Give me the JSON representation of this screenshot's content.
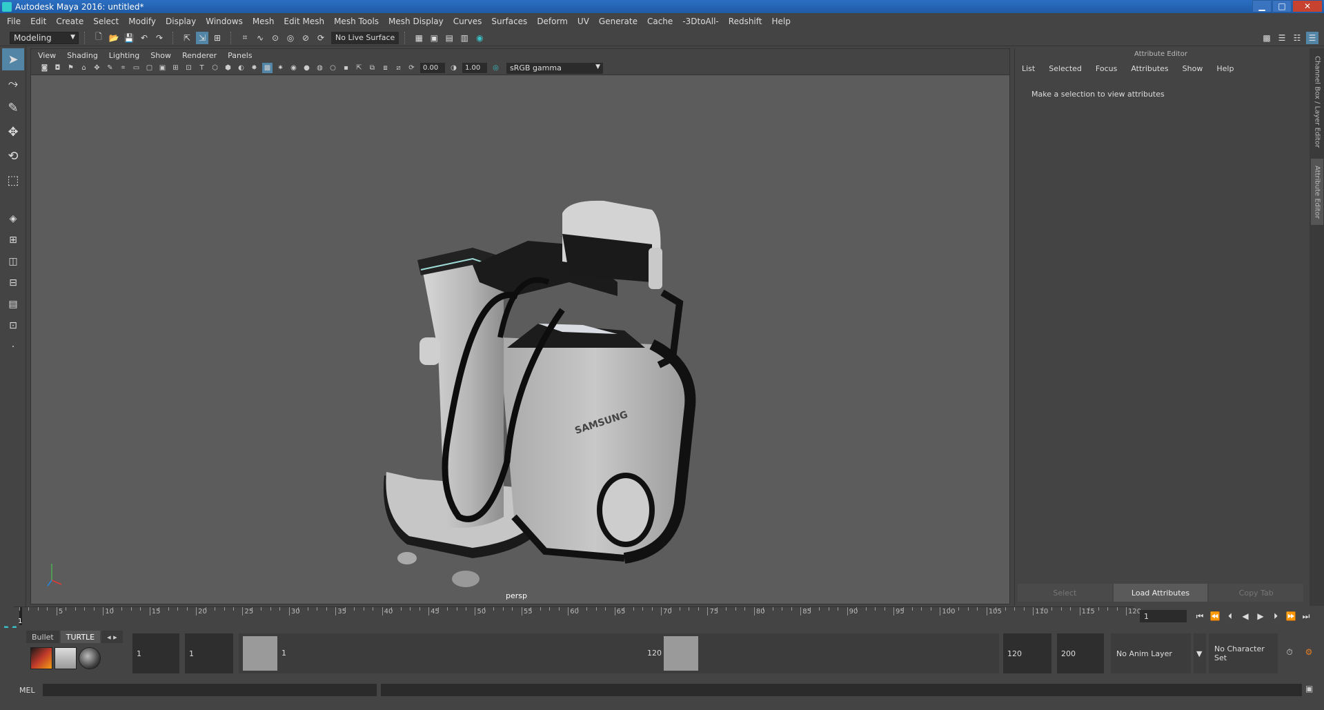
{
  "window": {
    "title": "Autodesk Maya 2016: untitled*"
  },
  "menu": [
    "File",
    "Edit",
    "Create",
    "Select",
    "Modify",
    "Display",
    "Windows",
    "Mesh",
    "Edit Mesh",
    "Mesh Tools",
    "Mesh Display",
    "Curves",
    "Surfaces",
    "Deform",
    "UV",
    "Generate",
    "Cache",
    "-3DtoAll-",
    "Redshift",
    "Help"
  ],
  "toolbar": {
    "mode": "Modeling",
    "live_surface": "No Live Surface"
  },
  "viewport": {
    "menu": [
      "View",
      "Shading",
      "Lighting",
      "Show",
      "Renderer",
      "Panels"
    ],
    "exposure": "0.00",
    "gamma": "1.00",
    "colorspace": "sRGB gamma",
    "camera": "persp",
    "model_brand": "SAMSUNG"
  },
  "attribute_editor": {
    "title": "Attribute Editor",
    "menu": [
      "List",
      "Selected",
      "Focus",
      "Attributes",
      "Show",
      "Help"
    ],
    "message": "Make a selection to view attributes",
    "buttons": {
      "select": "Select",
      "load": "Load Attributes",
      "copy": "Copy Tab"
    },
    "side_tabs": {
      "channel_box": "Channel Box / Layer Editor",
      "attribute_editor": "Attribute Editor"
    }
  },
  "timeline": {
    "ticks": [
      "5",
      "10",
      "15",
      "20",
      "25",
      "30",
      "35",
      "40",
      "45",
      "50",
      "55",
      "60",
      "65",
      "70",
      "75",
      "80",
      "85",
      "90",
      "95",
      "100",
      "105",
      "110",
      "115",
      "120"
    ],
    "current_frame_label": "1",
    "current_frame": "1"
  },
  "range": {
    "start": "1",
    "playback_start": "1",
    "range_start_label": "1",
    "range_end_label": "120",
    "playback_end": "120",
    "end": "200",
    "anim_layer": "No Anim Layer",
    "character_set": "No Character Set"
  },
  "shelf": {
    "tabs": [
      "Bullet",
      "TURTLE"
    ]
  },
  "command_line": {
    "label": "MEL"
  }
}
